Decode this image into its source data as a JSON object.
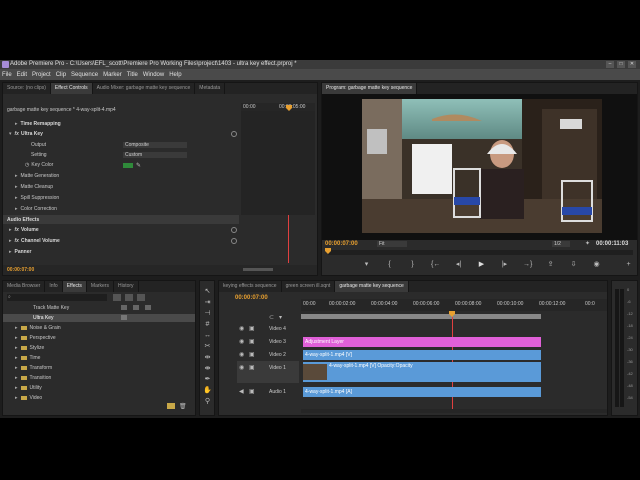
{
  "window": {
    "title": "Adobe Premiere Pro - C:\\Users\\EFL_scott\\Premiere Pro Working Files\\project\\1403 - ultra key effect.prproj *"
  },
  "menu": [
    "File",
    "Edit",
    "Project",
    "Clip",
    "Sequence",
    "Marker",
    "Title",
    "Window",
    "Help"
  ],
  "source_panel": {
    "tabs": [
      "Source: (no clips)",
      "Effect Controls",
      "Audio Mixer: garbage matte key sequence",
      "Metadata"
    ],
    "clip_name": "garbage matte key sequence * 4-way-split-4.mp4",
    "ruler_times": [
      "00:00",
      "00:00:05:00"
    ],
    "rows": {
      "time_remapping": "Time Remapping",
      "ultra_key": "Ultra Key",
      "output_label": "Output",
      "output_value": "Composite",
      "setting_label": "Setting",
      "setting_value": "Custom",
      "key_color": "Key Color",
      "matte_generation": "Matte Generation",
      "matte_cleanup": "Matte Cleanup",
      "spill_suppression": "Spill Suppression",
      "color_correction": "Color Correction",
      "audio_effects": "Audio Effects",
      "volume": "Volume",
      "channel_volume": "Channel Volume",
      "panner": "Panner"
    },
    "timecode": "00:00:07:00",
    "key_color_swatch": "#2f8a3a"
  },
  "program_panel": {
    "tab": "Program: garbage matte key sequence",
    "timecode_left": "00:00:07:00",
    "fit": "Fit",
    "ratio": "1/2",
    "timecode_right": "00:00:11:03"
  },
  "effects_panel": {
    "tabs": [
      "Media Browser",
      "Info",
      "Effects",
      "Markers",
      "History"
    ],
    "items": [
      {
        "label": "Track Matte Key",
        "folder": false
      },
      {
        "label": "Ultra Key",
        "folder": false
      },
      {
        "label": "Noise & Grain",
        "folder": true
      },
      {
        "label": "Perspective",
        "folder": true
      },
      {
        "label": "Stylize",
        "folder": true
      },
      {
        "label": "Time",
        "folder": true
      },
      {
        "label": "Transform",
        "folder": true
      },
      {
        "label": "Transition",
        "folder": true
      },
      {
        "label": "Utility",
        "folder": true
      },
      {
        "label": "Video",
        "folder": true
      }
    ]
  },
  "timeline_panel": {
    "tabs": [
      "keying effects sequence",
      "green screen ill.sqnt",
      "garbage matte key sequence"
    ],
    "timecode": "00:00:07:00",
    "ruler": [
      "00:00",
      "00:00:02:00",
      "00:00:04:00",
      "00:00:06:00",
      "00:00:08:00",
      "00:00:10:00",
      "00:00:12:00",
      "00:0"
    ],
    "tracks": [
      "Video 4",
      "Video 3",
      "Video 2",
      "Video 1",
      "Audio 1"
    ],
    "clips": {
      "adjustment": "Adjustment Layer",
      "video2": "4-way-split-1.mp4 [V]",
      "video1": "4-way-split-1.mp4 [V]  Opacity:Opacity",
      "audio1": "4-way-split-1.mp4 [A]"
    }
  },
  "audio_meter": {
    "labels": [
      "0",
      "-6",
      "-12",
      "-18",
      "-24",
      "-30",
      "-36",
      "-42",
      "-48",
      "-54"
    ]
  },
  "colors": {
    "playhead": "#e04040",
    "timecode": "#e8a030",
    "adjustment_clip": "#e060d8",
    "video_clip": "#5a9ad8",
    "audio_clip": "#5a9ad8"
  }
}
